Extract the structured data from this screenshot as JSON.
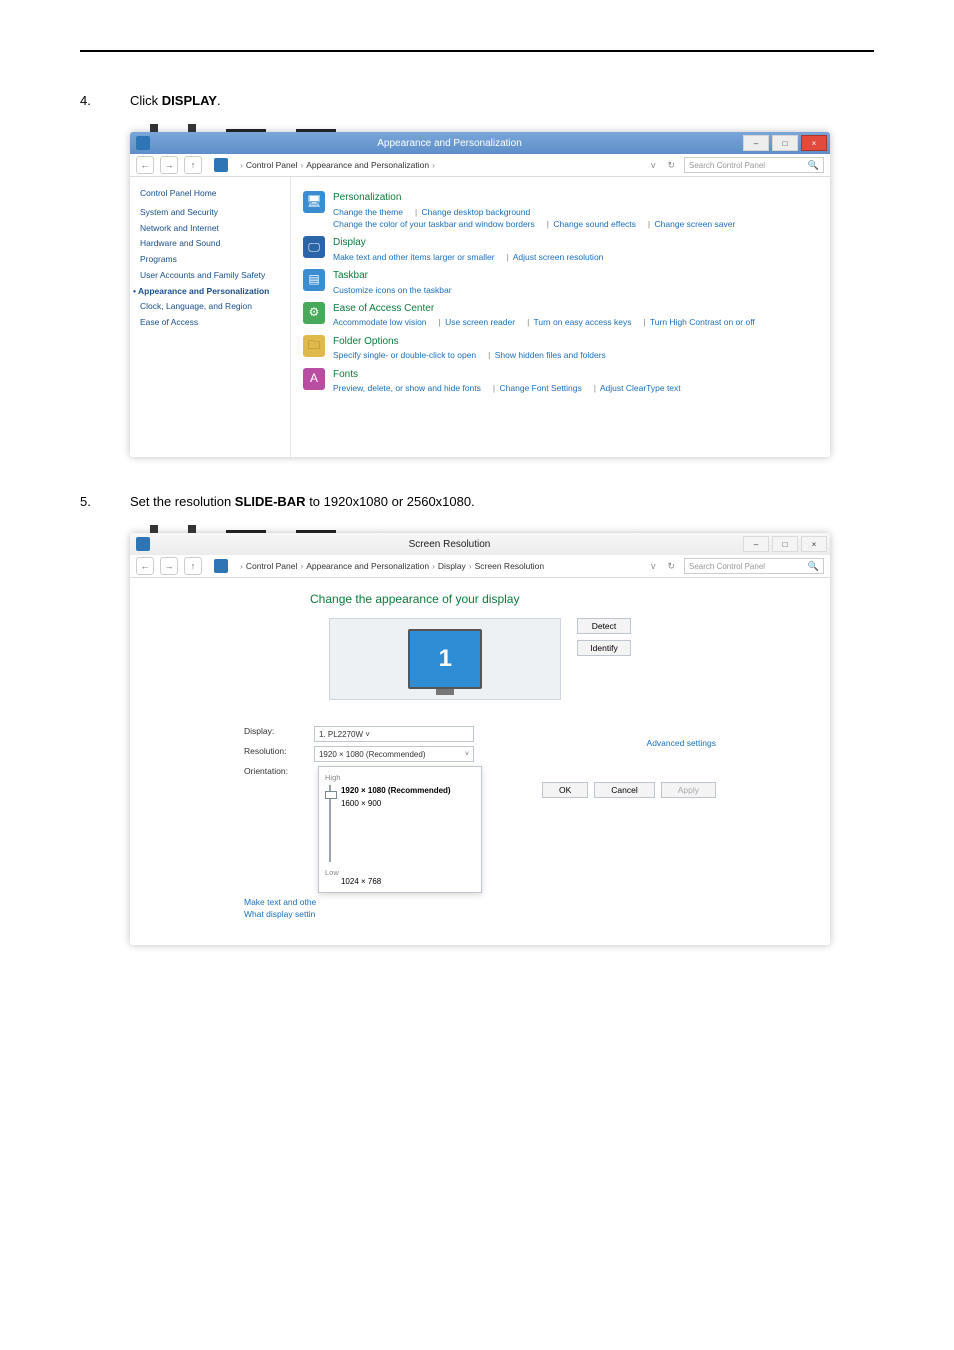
{
  "steps": {
    "s4": {
      "num": "4.",
      "pre": "Click ",
      "bold": "DISPLAY",
      "post": "."
    },
    "s5": {
      "num": "5.",
      "pre": "Set the resolution ",
      "bold": "SLIDE-BAR",
      "post": " to 1920x1080 or 2560x1080."
    }
  },
  "shot1": {
    "title": "Appearance and Personalization",
    "ctrl_min": "–",
    "ctrl_max": "□",
    "ctrl_close": "×",
    "nav_back": "←",
    "nav_fwd": "→",
    "nav_up": "↑",
    "crumbs": [
      "Control Panel",
      "Appearance and Personalization"
    ],
    "crumb_sep": "›",
    "refresh": "↻",
    "search_ph": "Search Control Panel",
    "mag": "🔍",
    "sidebar": {
      "header": "Control Panel Home",
      "items": [
        "System and Security",
        "Network and Internet",
        "Hardware and Sound",
        "Programs",
        "User Accounts and Family Safety"
      ],
      "current_marker": "•",
      "current": "Appearance and Personalization",
      "items2": [
        "Clock, Language, and Region",
        "Ease of Access"
      ]
    },
    "cats": {
      "pers": {
        "h": "Personalization",
        "l": [
          "Change the theme",
          "Change desktop background",
          "Change the color of your taskbar and window borders",
          "Change sound effects",
          "Change screen saver"
        ]
      },
      "disp": {
        "h": "Display",
        "l": [
          "Make text and other items larger or smaller",
          "Adjust screen resolution"
        ]
      },
      "task": {
        "h": "Taskbar",
        "l": [
          "Customize icons on the taskbar"
        ]
      },
      "ease": {
        "h": "Ease of Access Center",
        "l": [
          "Accommodate low vision",
          "Use screen reader",
          "Turn on easy access keys",
          "Turn High Contrast on or off"
        ]
      },
      "fold": {
        "h": "Folder Options",
        "l": [
          "Specify single- or double-click to open",
          "Show hidden files and folders"
        ]
      },
      "font": {
        "h": "Fonts",
        "l": [
          "Preview, delete, or show and hide fonts",
          "Change Font Settings",
          "Adjust ClearType text"
        ]
      }
    },
    "sep": "|"
  },
  "shot2": {
    "title": "Screen Resolution",
    "ctrl_min": "–",
    "ctrl_max": "□",
    "ctrl_close": "×",
    "nav_back": "←",
    "nav_fwd": "→",
    "nav_up": "↑",
    "crumbs": [
      "Control Panel",
      "Appearance and Personalization",
      "Display",
      "Screen Resolution"
    ],
    "crumb_sep": "›",
    "refresh": "↻",
    "search_ph": "Search Control Panel",
    "mag": "🔍",
    "heading": "Change the appearance of your display",
    "monitor": "1",
    "btn_detect": "Detect",
    "btn_identify": "Identify",
    "row_display": "Display:",
    "val_display": "1. PL2270W ˅",
    "row_res": "Resolution:",
    "val_res": "1920 × 1080 (Recommended)",
    "caret": "˅",
    "row_orient": "Orientation:",
    "pop": {
      "hi": "High",
      "rec": "1920 × 1080 (Recommended)",
      "mid": "1600 × 900",
      "low": "Low",
      "lowv": "1024 × 768"
    },
    "adv": "Advanced settings",
    "link1": "Make text and other items larger or smaller",
    "link2": "What display settings should I choose?",
    "truncated1": "Make text and othe",
    "truncated2": "What display settin",
    "ok": "OK",
    "cancel": "Cancel",
    "apply": "Apply"
  }
}
